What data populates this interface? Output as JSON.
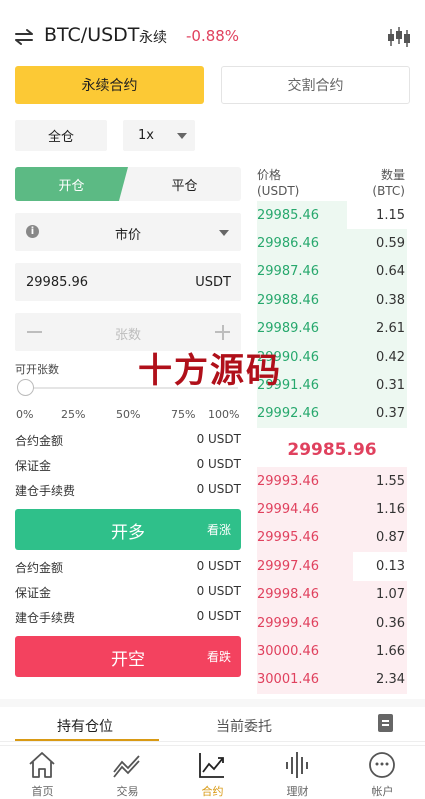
{
  "header": {
    "pair": "BTC/USDT",
    "contract_type": "永续",
    "change": "-0.88%",
    "swap_icon": "swap-arrows-icon",
    "kline_icon": "candlestick-icon"
  },
  "contract_tabs": [
    {
      "label": "永续合约",
      "active": true
    },
    {
      "label": "交割合约",
      "active": false
    }
  ],
  "margin_mode": "全仓",
  "leverage": "1x",
  "trade_mode": {
    "open": "开仓",
    "close": "平仓",
    "active": "open"
  },
  "order_type": "市价",
  "price": {
    "value": "29985.96",
    "unit": "USDT"
  },
  "quantity": {
    "placeholder": "张数"
  },
  "available_label": "可开张数",
  "slider": {
    "value": 0,
    "marks": [
      "0%",
      "25%",
      "50%",
      "75%",
      "100%"
    ]
  },
  "long_info": [
    {
      "label": "合约金额",
      "value": "0 USDT"
    },
    {
      "label": "保证金",
      "value": "0 USDT"
    },
    {
      "label": "建仓手续费",
      "value": "0 USDT"
    }
  ],
  "long_button": {
    "label": "开多",
    "sub": "看涨"
  },
  "short_info": [
    {
      "label": "合约金额",
      "value": "0 USDT"
    },
    {
      "label": "保证金",
      "value": "0 USDT"
    },
    {
      "label": "建仓手续费",
      "value": "0 USDT"
    }
  ],
  "short_button": {
    "label": "开空",
    "sub": "看跌"
  },
  "orderbook": {
    "price_header": "价格",
    "price_unit": "(USDT)",
    "qty_header": "数量",
    "qty_unit": "(BTC)",
    "bids": [
      {
        "price": "29985.46",
        "qty": "1.15",
        "depth": 0.6
      },
      {
        "price": "29986.46",
        "qty": "0.59",
        "depth": 1.0
      },
      {
        "price": "29987.46",
        "qty": "0.64",
        "depth": 1.0
      },
      {
        "price": "29988.46",
        "qty": "0.38",
        "depth": 1.0
      },
      {
        "price": "29989.46",
        "qty": "2.61",
        "depth": 1.0
      },
      {
        "price": "29990.46",
        "qty": "0.42",
        "depth": 1.0
      },
      {
        "price": "29991.46",
        "qty": "0.31",
        "depth": 1.0
      },
      {
        "price": "29992.46",
        "qty": "0.37",
        "depth": 1.0
      }
    ],
    "last_price": "29985.96",
    "asks": [
      {
        "price": "29993.46",
        "qty": "1.55",
        "depth": 1.0
      },
      {
        "price": "29994.46",
        "qty": "1.16",
        "depth": 1.0
      },
      {
        "price": "29995.46",
        "qty": "0.87",
        "depth": 1.0
      },
      {
        "price": "29997.46",
        "qty": "0.13",
        "depth": 0.64
      },
      {
        "price": "29998.46",
        "qty": "1.07",
        "depth": 1.0
      },
      {
        "price": "29999.46",
        "qty": "0.36",
        "depth": 1.0
      },
      {
        "price": "30000.46",
        "qty": "1.66",
        "depth": 1.0
      },
      {
        "price": "30001.46",
        "qty": "2.34",
        "depth": 1.0
      }
    ]
  },
  "watermark": "十方源码",
  "position_tabs": [
    {
      "label": "持有仓位",
      "active": true
    },
    {
      "label": "当前委托",
      "active": false
    }
  ],
  "nav": [
    {
      "label": "首页",
      "icon": "home-icon",
      "active": false
    },
    {
      "label": "交易",
      "icon": "trend-icon",
      "active": false
    },
    {
      "label": "合约",
      "icon": "contract-chart-icon",
      "active": true
    },
    {
      "label": "理财",
      "icon": "waveform-icon",
      "active": false
    },
    {
      "label": "帐户",
      "icon": "account-face-icon",
      "active": false
    }
  ],
  "colors": {
    "accent_yellow": "#fcc935",
    "up_green": "#2fc08a",
    "up_text": "#27a86d",
    "down_red": "#f3425f",
    "down_text": "#e0415e",
    "open_toggle": "#5cba84",
    "bid_bg": "#edf8f1",
    "ask_bg": "#fdeef1",
    "nav_active": "#d99a14"
  }
}
